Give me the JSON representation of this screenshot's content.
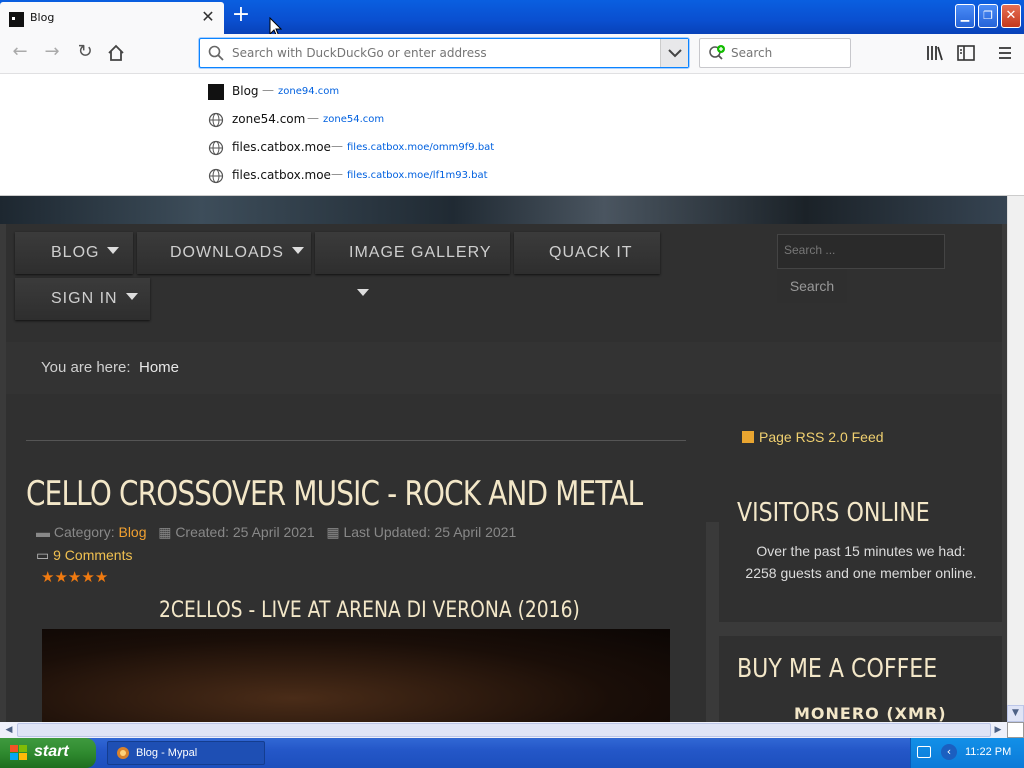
{
  "browser": {
    "tab": {
      "title": "Blog",
      "close": "✕"
    },
    "new_tab": "+",
    "url_placeholder": "Search with DuckDuckGo or enter address",
    "search_placeholder": "Search"
  },
  "suggestions": [
    {
      "title": "Blog",
      "url": "zone94.com",
      "icon": "site-favicon"
    },
    {
      "title": "zone54.com",
      "url": "zone54.com",
      "icon": "globe-icon"
    },
    {
      "title": "files.catbox.moe",
      "url": "files.catbox.moe/omm9f9.bat",
      "icon": "globe-icon"
    },
    {
      "title": "files.catbox.moe",
      "url": "files.catbox.moe/lf1m93.bat",
      "icon": "globe-icon"
    }
  ],
  "site": {
    "menu": {
      "blog": "BLOG",
      "downloads": "DOWNLOADS",
      "gallery": "IMAGE GALLERY",
      "quack": "QUACK IT",
      "signin": "SIGN IN"
    },
    "search_placeholder": "Search ...",
    "search_button": "Search",
    "breadcrumb": {
      "label": "You are here:",
      "home": "Home"
    },
    "article": {
      "title": "CELLO CROSSOVER MUSIC - ROCK AND METAL",
      "category_label": "Category:",
      "category": "Blog",
      "created": "Created: 25 April 2021",
      "updated": "Last Updated: 25 April 2021",
      "comments": "9 Comments",
      "rating": 5,
      "subtitle": "2CELLOS - LIVE AT ARENA DI VERONA (2016)"
    },
    "rss": "Page RSS 2.0 Feed",
    "visitors": {
      "title": "VISITORS ONLINE",
      "text": "Over the past 15 minutes we had: 2258 guests and one member online."
    },
    "coffee": {
      "title": "BUY ME A COFFEE",
      "monero": "MONERO (XMR)"
    }
  },
  "taskbar": {
    "start": "start",
    "window": "Blog - Mypal",
    "clock": "11:22 PM"
  },
  "colors": {
    "accent": "#0a84ff",
    "title_text": "#f3e7c8",
    "link": "#f0a030",
    "stars": "#f07a10"
  }
}
